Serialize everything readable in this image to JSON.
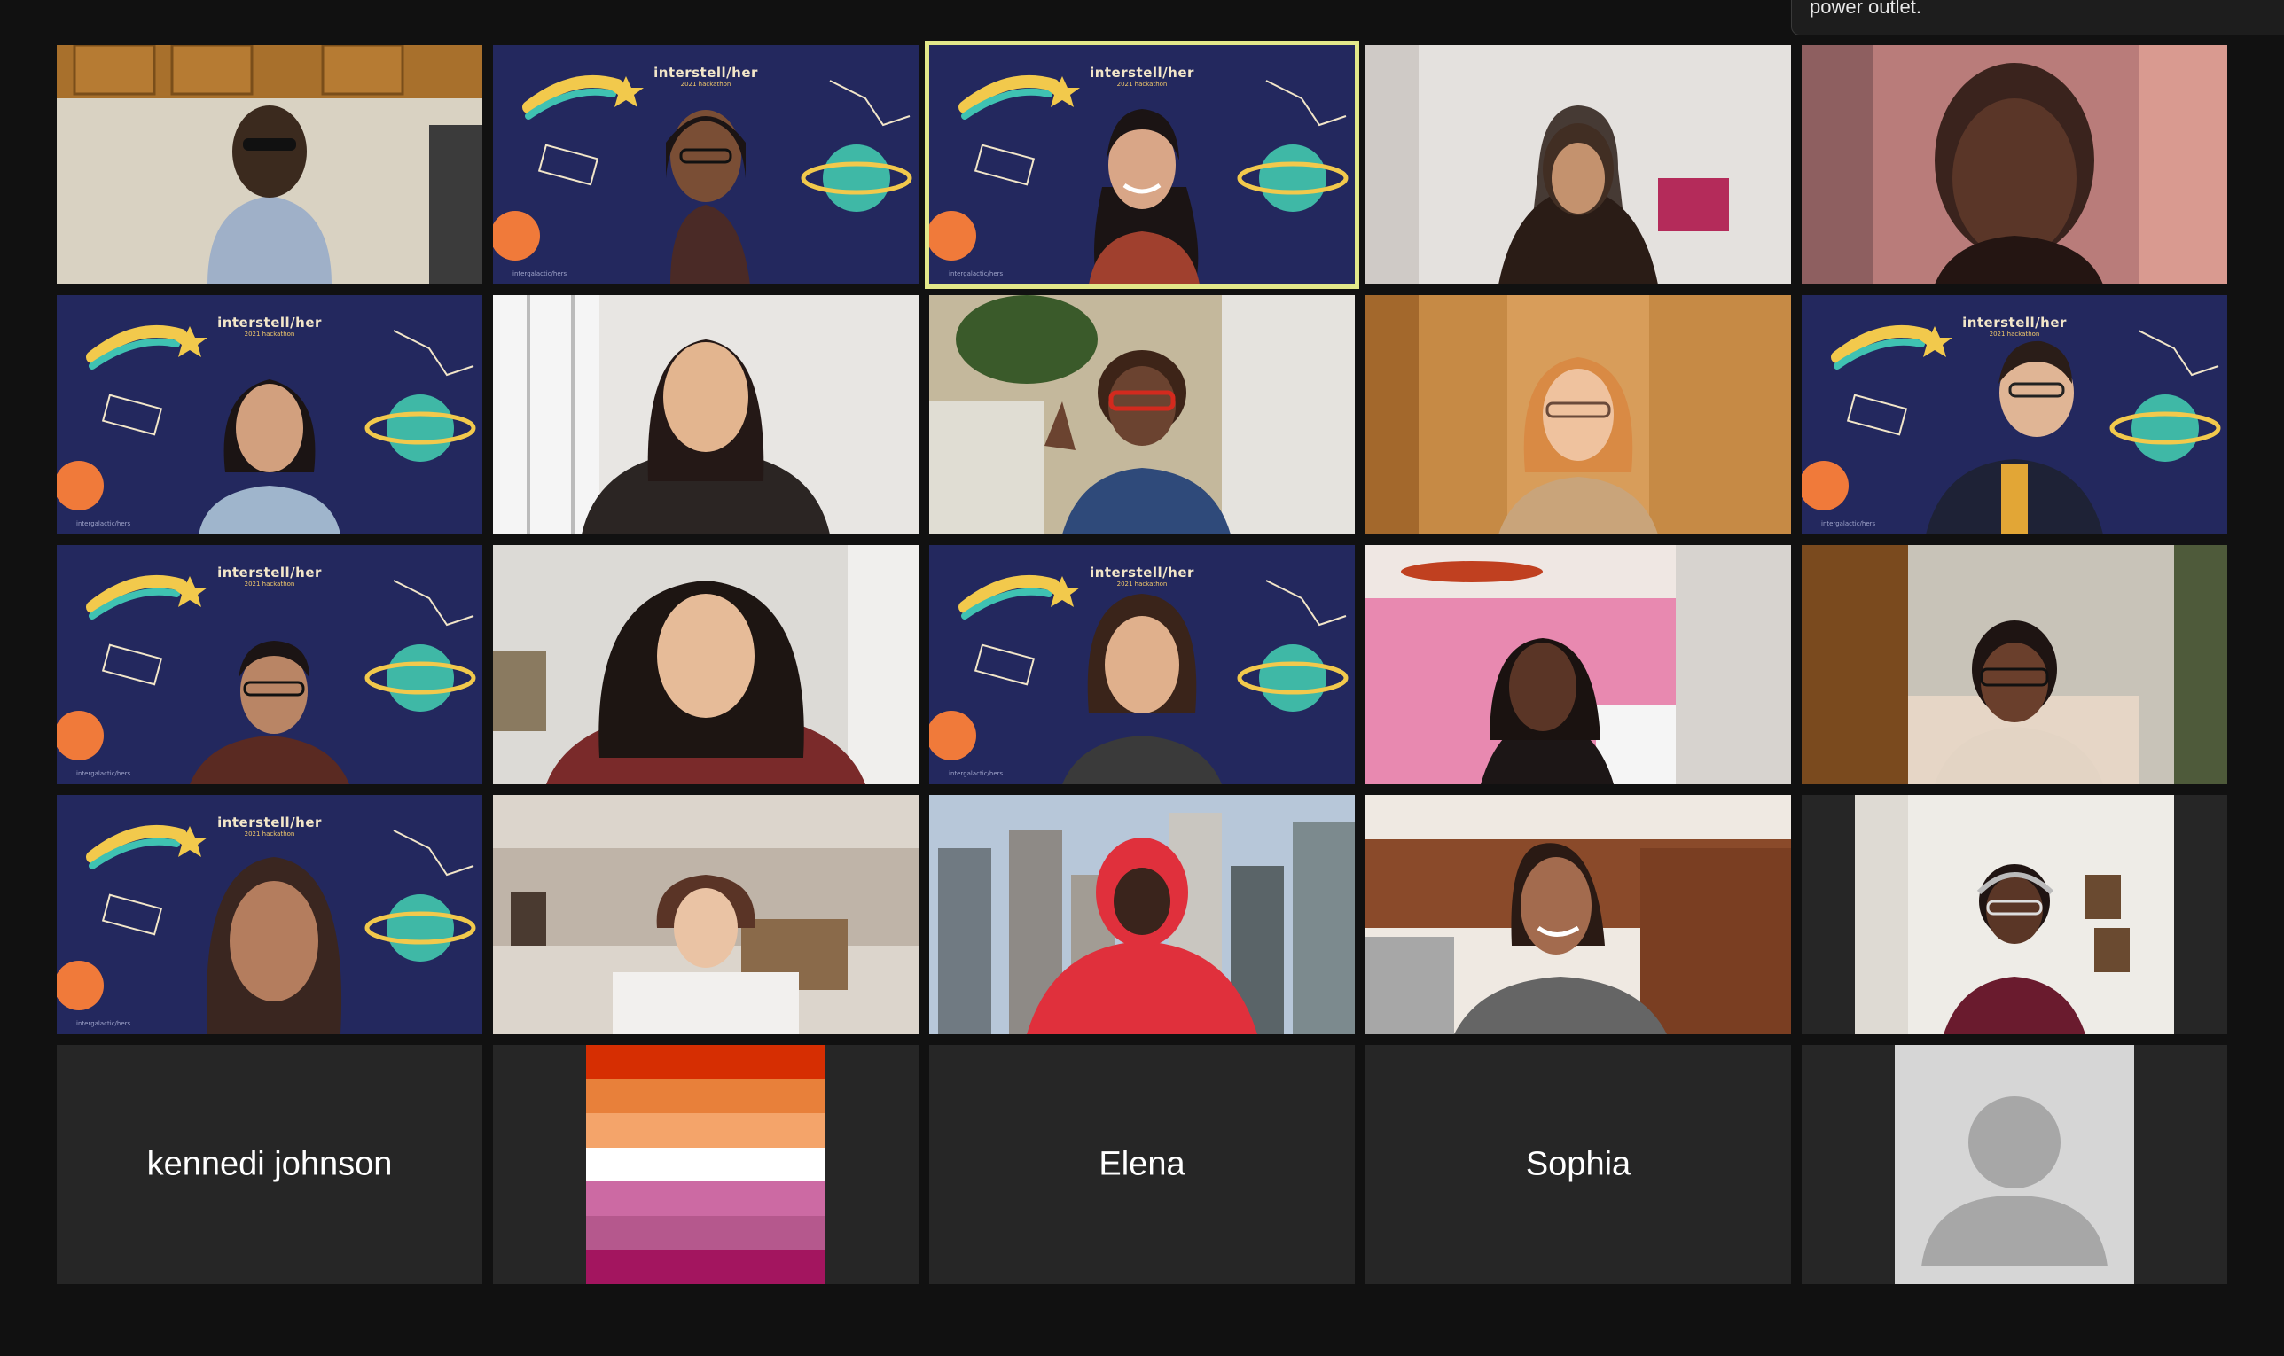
{
  "tooltip": {
    "text": "power outlet."
  },
  "virtual_background": {
    "title": "interstell/her",
    "subtitle": "2021 hackathon",
    "footer": "intergalactic/hers"
  },
  "participants": [
    {
      "id": "p1",
      "type": "video",
      "bg": "kitchen"
    },
    {
      "id": "p2",
      "type": "video",
      "bg": "space"
    },
    {
      "id": "p3",
      "type": "video",
      "bg": "space",
      "active": true
    },
    {
      "id": "p4",
      "type": "video",
      "bg": "room-gray"
    },
    {
      "id": "p5",
      "type": "video",
      "bg": "room-pink"
    },
    {
      "id": "p6",
      "type": "video",
      "bg": "space"
    },
    {
      "id": "p7",
      "type": "video",
      "bg": "window"
    },
    {
      "id": "p8",
      "type": "video",
      "bg": "plants"
    },
    {
      "id": "p9",
      "type": "video",
      "bg": "wood"
    },
    {
      "id": "p10",
      "type": "video",
      "bg": "space"
    },
    {
      "id": "p11",
      "type": "video",
      "bg": "space"
    },
    {
      "id": "p12",
      "type": "video",
      "bg": "bright-room"
    },
    {
      "id": "p13",
      "type": "video",
      "bg": "space"
    },
    {
      "id": "p14",
      "type": "video",
      "bg": "pink-ceiling"
    },
    {
      "id": "p15",
      "type": "video",
      "bg": "wood-room"
    },
    {
      "id": "p16",
      "type": "video",
      "bg": "space"
    },
    {
      "id": "p17",
      "type": "video",
      "bg": "living-room"
    },
    {
      "id": "p18",
      "type": "video",
      "bg": "city"
    },
    {
      "id": "p19",
      "type": "video",
      "bg": "kitchen-cabinets"
    },
    {
      "id": "p20",
      "type": "video",
      "bg": "hallway"
    },
    {
      "id": "p21",
      "type": "name",
      "name": "kennedi johnson"
    },
    {
      "id": "p22",
      "type": "flag"
    },
    {
      "id": "p23",
      "type": "name",
      "name": "Elena"
    },
    {
      "id": "p24",
      "type": "name",
      "name": "Sophia"
    },
    {
      "id": "p25",
      "type": "avatar"
    }
  ],
  "lesbian_flag_colors": [
    "#d62e02",
    "#e8803a",
    "#f4a46a",
    "#ffffff",
    "#cc6aa3",
    "#b5588d",
    "#a3155f"
  ],
  "colors": {
    "space_bg": "#23285e",
    "active_border": "#e3e88a",
    "tile_bg": "#262626",
    "app_bg": "#111111"
  }
}
